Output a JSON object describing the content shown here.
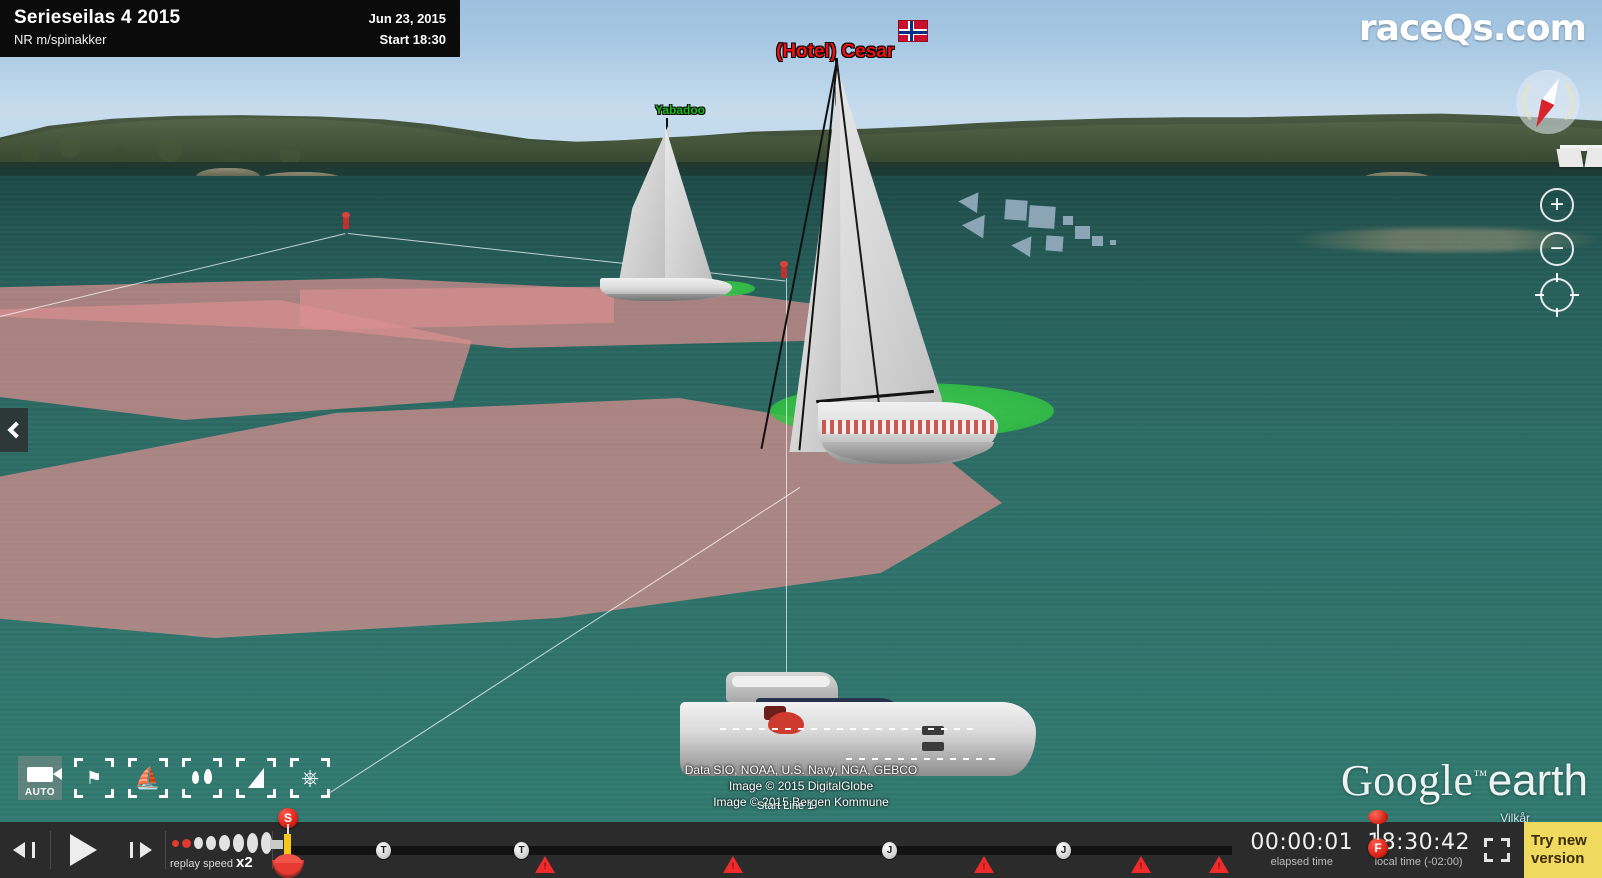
{
  "race_header": {
    "title": "Serieseilas 4 2015",
    "subtitle": "NR m/spinakker",
    "date": "Jun 23, 2015",
    "start": "Start 18:30"
  },
  "brand": {
    "raceqs_prefix": "race",
    "raceqs_q": "Q",
    "raceqs_suffix": "s.com"
  },
  "boats": [
    {
      "name": "(Hotel) Cesar",
      "color": "#ee1111",
      "flag": "norway-flag"
    },
    {
      "name": "Yabadoo",
      "color": "#14c414"
    }
  ],
  "map_labels": {
    "start_line": "Start Line 1"
  },
  "attribution": {
    "line1": "Data SIO, NOAA, U.S. Navy, NGA, GEBCO",
    "line2": "Image © 2015 DigitalGlobe",
    "line3": "Image © 2015 Bergen Kommune",
    "terms": "Vilkår"
  },
  "google_earth": {
    "word1": "Google",
    "tm": "™",
    "word2": "earth"
  },
  "nav_controls": {
    "compass": "compass-icon",
    "street_view": "pegman-icon",
    "zoom_in": "+",
    "zoom_out": "−",
    "look_around": "look-around-icon"
  },
  "camera_toolbar": {
    "items": [
      {
        "name": "camera-auto",
        "glyph": "▶",
        "label": "AUTO",
        "active": true
      },
      {
        "name": "map-view",
        "glyph": "⚑",
        "label": "",
        "active": false
      },
      {
        "name": "boat-view",
        "glyph": "⛵",
        "label": "",
        "active": false
      },
      {
        "name": "wind-view",
        "glyph": "∴",
        "label": "",
        "active": false
      },
      {
        "name": "sail-view",
        "glyph": "◢",
        "label": "",
        "active": false
      },
      {
        "name": "helm-view",
        "glyph": "⎈",
        "label": "",
        "active": false
      }
    ]
  },
  "player": {
    "step_back": "step-back",
    "play": "play",
    "step_forward": "step-forward",
    "replay_speed_label": "replay speed",
    "replay_speed_value": "x2",
    "replay_speed_dots_total": 8,
    "replay_speed_dots_active": 2,
    "elapsed_time": "00:00:01",
    "elapsed_time_label": "elapsed time",
    "local_time": "18:30:42",
    "local_time_label": "local time (-02:00)",
    "fullscreen": "fullscreen-icon",
    "try_new_line1": "Try new",
    "try_new_line2": "version"
  },
  "timeline": {
    "start_marker": "S",
    "finish_marker": "F",
    "markers": [
      {
        "label": "T",
        "pos_pct": 6.5
      },
      {
        "label": "T",
        "pos_pct": 17.0
      },
      {
        "label": "J",
        "pos_pct": 44.0
      },
      {
        "label": "J",
        "pos_pct": 56.5
      }
    ],
    "alerts": [
      {
        "pos_pct": 19.4
      },
      {
        "pos_pct": 33.2
      },
      {
        "pos_pct": 51.6
      },
      {
        "pos_pct": 63.2
      },
      {
        "pos_pct": 68.8
      }
    ],
    "playhead_pos_pct": 0.5,
    "finish_pos_pct": 82.5
  },
  "colors": {
    "panel_bg": "#0b0b0b",
    "player_bg": "#2b2b2b",
    "accent_yellow": "#efd95e",
    "alert_red": "#ee2a2a",
    "water": "#2e7069",
    "track_pink": "#d98f8f",
    "zone_green": "#35c744"
  }
}
